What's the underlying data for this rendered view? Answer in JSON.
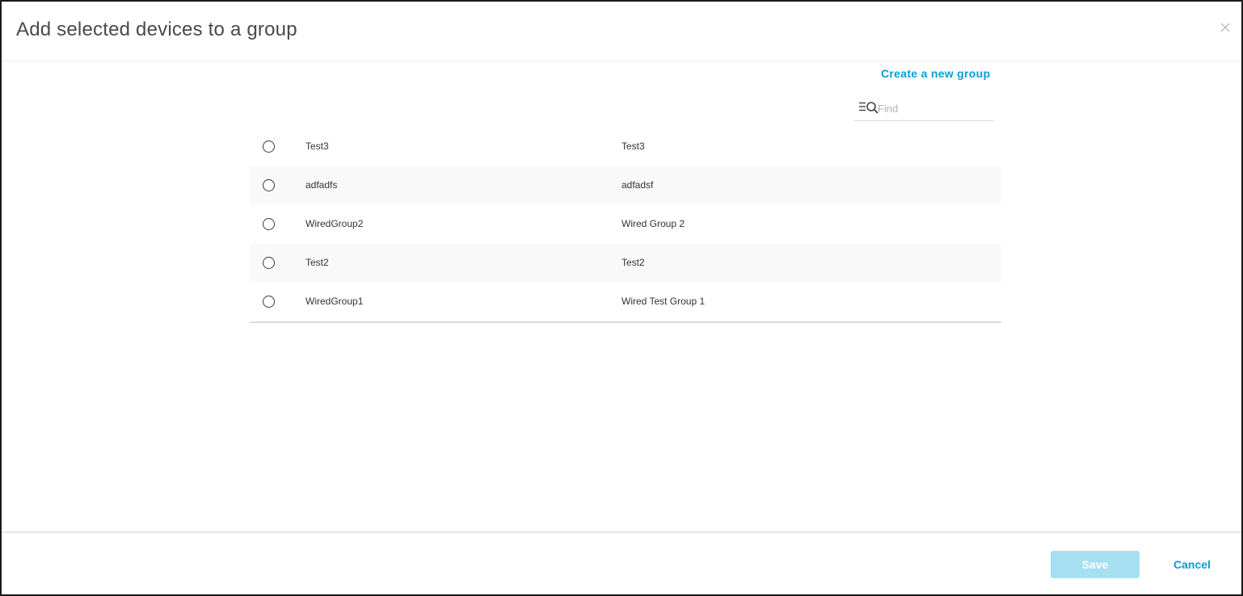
{
  "dialog": {
    "title": "Add selected devices to a group"
  },
  "create_group_link": "Create a new group",
  "search": {
    "placeholder": "Find",
    "value": ""
  },
  "groups": [
    {
      "name": "Test3",
      "description": "Test3",
      "selected": false
    },
    {
      "name": "adfadfs",
      "description": "adfadsf",
      "selected": false
    },
    {
      "name": "WiredGroup2",
      "description": "Wired Group 2",
      "selected": false
    },
    {
      "name": "Test2",
      "description": "Test2",
      "selected": false
    },
    {
      "name": "WiredGroup1",
      "description": "Wired Test Group 1",
      "selected": false
    }
  ],
  "footer": {
    "save_label": "Save",
    "cancel_label": "Cancel"
  },
  "colors": {
    "accent": "#049fd9",
    "save_disabled": "#a7dff2",
    "row_alt": "#f9f9f9"
  },
  "icons": {
    "close": "close-icon",
    "find": "filter-search-icon",
    "radio": "radio-unchecked-icon"
  }
}
